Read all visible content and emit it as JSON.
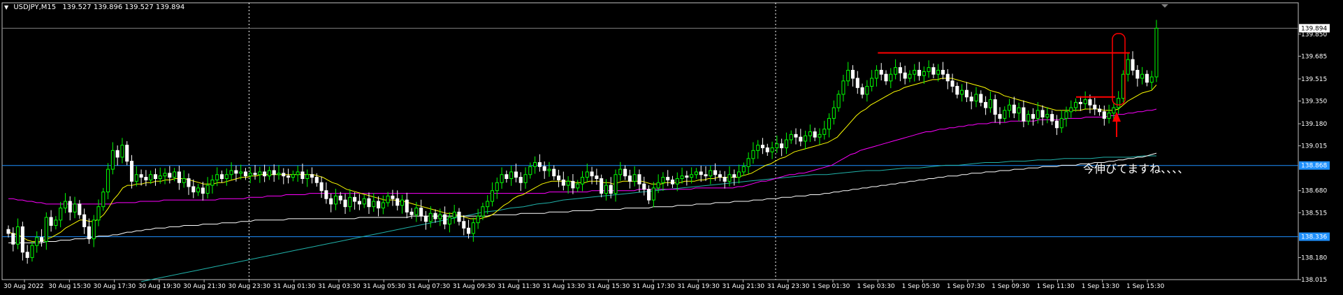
{
  "header": {
    "symbol": "USDJPY,M15",
    "ohlc": "139.527 139.896 139.527 139.894"
  },
  "annotation_text": "今伸びてますね、、、、",
  "colors": {
    "background": "#000000",
    "border": "#c0c0c0",
    "bull": "#00ff00",
    "bear": "#ffffff",
    "ma_fast": "#ffff00",
    "ma_mid": "#ff00ff",
    "ma_slow": "#ffffff",
    "ma_long": "#20b2aa",
    "hline": "#1e90ff",
    "resistance": "#ff0000"
  },
  "chart_data": {
    "type": "candlestick",
    "symbol": "USDJPY",
    "timeframe": "M15",
    "ylim": [
      138.015,
      139.99
    ],
    "y_ticks": [
      139.85,
      139.685,
      139.515,
      139.35,
      139.18,
      139.015,
      138.68,
      138.515,
      138.18,
      138.015
    ],
    "price_labels": [
      {
        "value": 139.894,
        "label": "139.894",
        "style": "current"
      },
      {
        "value": 138.868,
        "label": "138.868",
        "style": "hline"
      },
      {
        "value": 138.336,
        "label": "138.336",
        "style": "hline"
      },
      {
        "value": 138.85,
        "label": "138.850",
        "style": "tick"
      }
    ],
    "x_labels": [
      "30 Aug 2022",
      "30 Aug 15:30",
      "30 Aug 17:30",
      "30 Aug 19:30",
      "30 Aug 21:30",
      "30 Aug 23:30",
      "31 Aug 01:30",
      "31 Aug 03:30",
      "31 Aug 05:30",
      "31 Aug 07:30",
      "31 Aug 09:30",
      "31 Aug 11:30",
      "31 Aug 13:30",
      "31 Aug 15:30",
      "31 Aug 17:30",
      "31 Aug 19:30",
      "31 Aug 21:30",
      "31 Aug 23:30",
      "1 Sep 01:30",
      "1 Sep 03:30",
      "1 Sep 05:30",
      "1 Sep 07:30",
      "1 Sep 09:30",
      "1 Sep 11:30",
      "1 Sep 13:30",
      "1 Sep 15:30"
    ],
    "day_separators": [
      "30 Aug 23:30",
      "1 Sep 00:00"
    ],
    "horizontal_lines": [
      138.868,
      138.336
    ],
    "resistance_lines": [
      {
        "from": "1 Sep 03:30",
        "to": "1 Sep 14:45",
        "value": 139.71
      },
      {
        "from": "1 Sep 13:00",
        "to": "1 Sep 14:00",
        "value": 139.38
      }
    ],
    "close_series": [
      138.36,
      138.28,
      138.41,
      138.22,
      138.18,
      138.27,
      138.33,
      138.3,
      138.48,
      138.42,
      138.46,
      138.55,
      138.6,
      138.52,
      138.58,
      138.5,
      138.41,
      138.32,
      138.46,
      138.56,
      138.67,
      138.84,
      138.98,
      138.93,
      139.02,
      138.9,
      138.75,
      138.8,
      138.78,
      138.76,
      138.8,
      138.77,
      138.79,
      138.81,
      138.78,
      138.82,
      138.74,
      138.77,
      138.71,
      138.67,
      138.7,
      138.66,
      138.72,
      138.76,
      138.8,
      138.77,
      138.8,
      138.83,
      138.81,
      138.82,
      138.79,
      138.81,
      138.8,
      138.82,
      138.79,
      138.83,
      138.8,
      138.81,
      138.79,
      138.78,
      138.8,
      138.82,
      138.77,
      138.8,
      138.78,
      138.74,
      138.68,
      138.62,
      138.58,
      138.64,
      138.61,
      138.56,
      138.63,
      138.6,
      138.58,
      138.62,
      138.56,
      138.6,
      138.55,
      138.59,
      138.64,
      138.62,
      138.57,
      138.61,
      138.52,
      138.5,
      138.55,
      138.49,
      138.45,
      138.51,
      138.47,
      138.5,
      138.43,
      138.48,
      138.52,
      138.45,
      138.4,
      138.36,
      138.44,
      138.49,
      138.56,
      138.6,
      138.68,
      138.74,
      138.8,
      138.77,
      138.82,
      138.78,
      138.74,
      138.8,
      138.86,
      138.89,
      138.86,
      138.83,
      138.84,
      138.79,
      138.76,
      138.72,
      138.75,
      138.7,
      138.73,
      138.78,
      138.82,
      138.79,
      138.77,
      138.66,
      138.72,
      138.66,
      138.8,
      138.84,
      138.79,
      138.75,
      138.8,
      138.73,
      138.69,
      138.61,
      138.7,
      138.74,
      138.78,
      138.76,
      138.73,
      138.77,
      138.79,
      138.78,
      138.8,
      138.82,
      138.8,
      138.79,
      138.83,
      138.8,
      138.78,
      138.75,
      138.8,
      138.78,
      138.82,
      138.86,
      138.92,
      138.98,
      139.02,
      139.0,
      138.97,
      139.0,
      139.03,
      139.0,
      139.06,
      139.1,
      139.08,
      139.05,
      139.09,
      139.12,
      139.08,
      139.1,
      139.14,
      139.22,
      139.3,
      139.4,
      139.5,
      139.58,
      139.52,
      139.45,
      139.4,
      139.46,
      139.52,
      139.58,
      139.55,
      139.5,
      139.55,
      139.6,
      139.56,
      139.52,
      139.55,
      139.58,
      139.54,
      139.57,
      139.6,
      139.55,
      139.58,
      139.55,
      139.5,
      139.46,
      139.4,
      139.43,
      139.38,
      139.35,
      139.4,
      139.34,
      139.3,
      139.36,
      139.25,
      139.22,
      139.28,
      139.32,
      139.26,
      139.3,
      139.2,
      139.25,
      139.22,
      139.28,
      139.23,
      139.25,
      139.2,
      139.15,
      139.22,
      139.27,
      139.3,
      139.34,
      139.33,
      139.36,
      139.32,
      139.29,
      139.27,
      139.22,
      139.26,
      139.3,
      139.37,
      139.55,
      139.66,
      139.58,
      139.52,
      139.55,
      139.49,
      139.53,
      139.894
    ],
    "ma_fast": [
      138.37,
      138.36,
      138.35,
      138.33,
      138.31,
      138.3,
      138.3,
      138.3,
      138.32,
      138.33,
      138.35,
      138.37,
      138.4,
      138.42,
      138.44,
      138.46,
      138.46,
      138.45,
      138.45,
      138.47,
      138.5,
      138.55,
      138.61,
      138.65,
      138.7,
      138.72,
      138.72,
      138.73,
      138.73,
      138.74,
      138.74,
      138.75,
      138.75,
      138.76,
      138.76,
      138.77,
      138.77,
      138.77,
      138.76,
      138.75,
      138.74,
      138.73,
      138.73,
      138.73,
      138.74,
      138.74,
      138.75,
      138.76,
      138.77,
      138.78,
      138.78,
      138.79,
      138.79,
      138.8,
      138.8,
      138.8,
      138.8,
      138.8,
      138.8,
      138.8,
      138.8,
      138.8,
      138.8,
      138.8,
      138.8,
      138.79,
      138.78,
      138.76,
      138.74,
      138.73,
      138.71,
      138.69,
      138.68,
      138.67,
      138.66,
      138.65,
      138.64,
      138.63,
      138.62,
      138.61,
      138.61,
      138.61,
      138.6,
      138.6,
      138.59,
      138.58,
      138.57,
      138.56,
      138.55,
      138.54,
      138.53,
      138.52,
      138.51,
      138.51,
      138.5,
      138.49,
      138.48,
      138.47,
      138.47,
      138.47,
      138.48,
      138.49,
      138.51,
      138.54,
      138.57,
      138.59,
      138.62,
      138.64,
      138.65,
      138.67,
      138.69,
      138.71,
      138.73,
      138.74,
      138.75,
      138.75,
      138.75,
      138.75,
      138.75,
      138.74,
      138.74,
      138.74,
      138.75,
      138.75,
      138.75,
      138.74,
      138.74,
      138.73,
      138.74,
      138.75,
      138.75,
      138.75,
      138.75,
      138.75,
      138.74,
      138.73,
      138.73,
      138.73,
      138.74,
      138.74,
      138.74,
      138.74,
      138.75,
      138.75,
      138.75,
      138.76,
      138.76,
      138.77,
      138.77,
      138.78,
      138.78,
      138.78,
      138.78,
      138.78,
      138.79,
      138.8,
      138.81,
      138.83,
      138.85,
      138.87,
      138.88,
      138.9,
      138.92,
      138.93,
      138.95,
      138.97,
      138.98,
      138.99,
      139.0,
      139.01,
      139.02,
      139.03,
      139.04,
      139.06,
      139.08,
      139.12,
      139.16,
      139.2,
      139.24,
      139.27,
      139.29,
      139.32,
      139.34,
      139.36,
      139.38,
      139.4,
      139.42,
      139.43,
      139.45,
      139.46,
      139.47,
      139.48,
      139.49,
      139.5,
      139.51,
      139.51,
      139.52,
      139.52,
      139.52,
      139.51,
      139.5,
      139.49,
      139.48,
      139.47,
      139.46,
      139.45,
      139.43,
      139.42,
      139.41,
      139.39,
      139.38,
      139.37,
      139.36,
      139.35,
      139.34,
      139.33,
      139.32,
      139.31,
      139.3,
      139.29,
      139.28,
      139.28,
      139.28,
      139.28,
      139.28,
      139.28,
      139.29,
      139.29,
      139.29,
      139.29,
      139.28,
      139.28,
      139.28,
      139.29,
      139.32,
      139.35,
      139.37,
      139.39,
      139.41,
      139.42,
      139.43,
      139.47
    ],
    "ma_mid": [
      138.62,
      138.62,
      138.61,
      138.61,
      138.6,
      138.6,
      138.59,
      138.59,
      138.58,
      138.58,
      138.58,
      138.58,
      138.58,
      138.58,
      138.58,
      138.58,
      138.58,
      138.58,
      138.58,
      138.58,
      138.58,
      138.58,
      138.58,
      138.59,
      138.59,
      138.59,
      138.59,
      138.59,
      138.6,
      138.6,
      138.6,
      138.6,
      138.6,
      138.61,
      138.61,
      138.61,
      138.61,
      138.61,
      138.61,
      138.61,
      138.61,
      138.61,
      138.61,
      138.61,
      138.61,
      138.62,
      138.62,
      138.62,
      138.62,
      138.62,
      138.62,
      138.63,
      138.63,
      138.63,
      138.63,
      138.64,
      138.64,
      138.64,
      138.64,
      138.65,
      138.65,
      138.65,
      138.65,
      138.65,
      138.66,
      138.66,
      138.66,
      138.66,
      138.66,
      138.66,
      138.66,
      138.66,
      138.66,
      138.66,
      138.66,
      138.66,
      138.66,
      138.66,
      138.66,
      138.66,
      138.66,
      138.66,
      138.66,
      138.66,
      138.66,
      138.66,
      138.66,
      138.66,
      138.66,
      138.66,
      138.66,
      138.66,
      138.66,
      138.66,
      138.66,
      138.66,
      138.66,
      138.66,
      138.66,
      138.66,
      138.66,
      138.66,
      138.66,
      138.66,
      138.66,
      138.66,
      138.66,
      138.66,
      138.66,
      138.66,
      138.66,
      138.66,
      138.66,
      138.66,
      138.66,
      138.67,
      138.67,
      138.67,
      138.67,
      138.67,
      138.67,
      138.67,
      138.67,
      138.67,
      138.68,
      138.68,
      138.68,
      138.68,
      138.68,
      138.68,
      138.68,
      138.68,
      138.68,
      138.68,
      138.69,
      138.69,
      138.69,
      138.69,
      138.69,
      138.69,
      138.69,
      138.69,
      138.69,
      138.69,
      138.69,
      138.69,
      138.7,
      138.7,
      138.7,
      138.7,
      138.7,
      138.7,
      138.7,
      138.7,
      138.7,
      138.71,
      138.71,
      138.72,
      138.73,
      138.74,
      138.75,
      138.75,
      138.76,
      138.77,
      138.78,
      138.79,
      138.8,
      138.8,
      138.81,
      138.81,
      138.82,
      138.83,
      138.84,
      138.85,
      138.86,
      138.87,
      138.89,
      138.91,
      138.93,
      138.95,
      138.96,
      138.98,
      138.99,
      139.0,
      139.01,
      139.02,
      139.03,
      139.04,
      139.05,
      139.06,
      139.07,
      139.08,
      139.09,
      139.1,
      139.11,
      139.12,
      139.12,
      139.13,
      139.14,
      139.14,
      139.15,
      139.15,
      139.16,
      139.16,
      139.17,
      139.17,
      139.18,
      139.18,
      139.18,
      139.19,
      139.19,
      139.19,
      139.19,
      139.2,
      139.2,
      139.2,
      139.2,
      139.2,
      139.2,
      139.21,
      139.21,
      139.21,
      139.21,
      139.21,
      139.21,
      139.22,
      139.22,
      139.22,
      139.22,
      139.23,
      139.23,
      139.23,
      139.23,
      139.23,
      139.24,
      139.24,
      139.25,
      139.25,
      139.26,
      139.26,
      139.27,
      139.27,
      139.28,
      139.28,
      139.29
    ],
    "ma_slow": [
      138.29,
      138.29,
      138.29,
      138.29,
      138.29,
      138.29,
      138.29,
      138.29,
      138.3,
      138.3,
      138.3,
      138.31,
      138.31,
      138.31,
      138.32,
      138.32,
      138.32,
      138.33,
      138.33,
      138.34,
      138.34,
      138.34,
      138.35,
      138.35,
      138.36,
      138.37,
      138.37,
      138.38,
      138.38,
      138.39,
      138.39,
      138.4,
      138.4,
      138.4,
      138.41,
      138.41,
      138.41,
      138.42,
      138.42,
      138.42,
      138.42,
      138.43,
      138.43,
      138.43,
      138.43,
      138.44,
      138.44,
      138.44,
      138.44,
      138.45,
      138.45,
      138.45,
      138.46,
      138.46,
      138.46,
      138.46,
      138.46,
      138.46,
      138.46,
      138.47,
      138.47,
      138.47,
      138.47,
      138.47,
      138.47,
      138.47,
      138.47,
      138.47,
      138.47,
      138.47,
      138.47,
      138.47,
      138.47,
      138.47,
      138.48,
      138.48,
      138.48,
      138.48,
      138.48,
      138.48,
      138.48,
      138.48,
      138.48,
      138.48,
      138.48,
      138.49,
      138.49,
      138.49,
      138.49,
      138.49,
      138.49,
      138.49,
      138.49,
      138.49,
      138.49,
      138.49,
      138.49,
      138.49,
      138.49,
      138.49,
      138.49,
      138.49,
      138.5,
      138.5,
      138.5,
      138.5,
      138.5,
      138.5,
      138.51,
      138.51,
      138.51,
      138.51,
      138.51,
      138.51,
      138.52,
      138.52,
      138.52,
      138.52,
      138.52,
      138.53,
      138.53,
      138.53,
      138.53,
      138.53,
      138.54,
      138.54,
      138.54,
      138.54,
      138.54,
      138.54,
      138.55,
      138.55,
      138.55,
      138.55,
      138.55,
      138.55,
      138.56,
      138.56,
      138.56,
      138.56,
      138.56,
      138.57,
      138.57,
      138.57,
      138.57,
      138.58,
      138.58,
      138.58,
      138.58,
      138.59,
      138.59,
      138.59,
      138.59,
      138.6,
      138.6,
      138.6,
      138.6,
      138.61,
      138.61,
      138.61,
      138.62,
      138.62,
      138.62,
      138.63,
      138.63,
      138.63,
      138.64,
      138.64,
      138.64,
      138.65,
      138.65,
      138.65,
      138.66,
      138.66,
      138.67,
      138.67,
      138.68,
      138.68,
      138.69,
      138.69,
      138.7,
      138.7,
      138.71,
      138.71,
      138.72,
      138.72,
      138.73,
      138.73,
      138.74,
      138.74,
      138.75,
      138.75,
      138.76,
      138.76,
      138.77,
      138.77,
      138.78,
      138.78,
      138.79,
      138.79,
      138.79,
      138.8,
      138.8,
      138.81,
      138.81,
      138.81,
      138.82,
      138.82,
      138.82,
      138.83,
      138.83,
      138.83,
      138.84,
      138.84,
      138.84,
      138.85,
      138.85,
      138.85,
      138.86,
      138.86,
      138.86,
      138.86,
      138.87,
      138.87,
      138.87,
      138.87,
      138.88,
      138.88,
      138.88,
      138.89,
      138.89,
      138.89,
      138.9,
      138.9,
      138.91,
      138.91,
      138.92,
      138.92,
      138.93,
      138.93,
      138.94,
      138.95,
      138.96
    ],
    "ma_long": [
      138.0,
      138.02,
      138.04,
      138.06,
      138.08,
      138.1,
      138.12,
      138.14,
      138.16,
      138.18,
      138.2,
      138.22,
      138.24,
      138.26,
      138.28,
      138.3,
      138.32,
      138.34,
      138.36,
      138.38,
      138.4,
      138.42,
      138.44,
      138.46,
      138.48,
      138.5,
      138.52,
      138.53,
      138.55,
      138.56,
      138.58,
      138.59,
      138.61,
      138.62,
      138.63,
      138.64,
      138.65,
      138.66,
      138.67,
      138.68,
      138.69,
      138.7,
      138.71,
      138.72,
      138.73,
      138.74,
      138.75,
      138.76,
      138.77,
      138.78,
      138.79,
      138.8,
      138.8,
      138.81,
      138.82,
      138.83,
      138.83,
      138.84,
      138.85,
      138.85,
      138.86,
      138.87,
      138.87,
      138.88,
      138.89,
      138.89,
      138.9,
      138.9,
      138.91,
      138.91,
      138.92,
      138.92,
      138.92,
      138.93,
      138.93,
      138.93,
      138.94,
      138.94
    ]
  }
}
